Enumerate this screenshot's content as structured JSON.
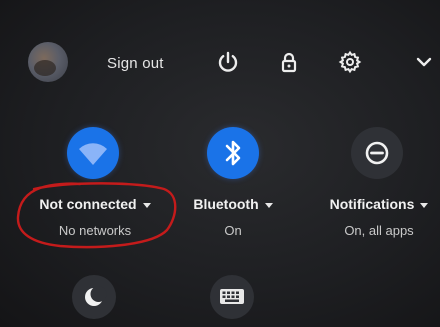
{
  "top_bar": {
    "sign_out_label": "Sign out",
    "icons": [
      "power-icon",
      "lock-icon",
      "gear-icon",
      "chevron-down-icon"
    ]
  },
  "tiles": [
    {
      "icon": "wifi-icon",
      "label": "Not connected",
      "sublabel": "No networks",
      "state": "on"
    },
    {
      "icon": "bluetooth-icon",
      "label": "Bluetooth",
      "sublabel": "On",
      "state": "on"
    },
    {
      "icon": "do-not-disturb-icon",
      "label": "Notifications",
      "sublabel": "On, all apps",
      "state": "off"
    }
  ],
  "bottom_tiles": [
    {
      "icon": "night-light-icon"
    },
    {
      "icon": "keyboard-icon"
    }
  ],
  "colors": {
    "active_tile": "#1a73e8",
    "inactive_tile": "#2f3136",
    "annotation": "#c41b1b"
  }
}
